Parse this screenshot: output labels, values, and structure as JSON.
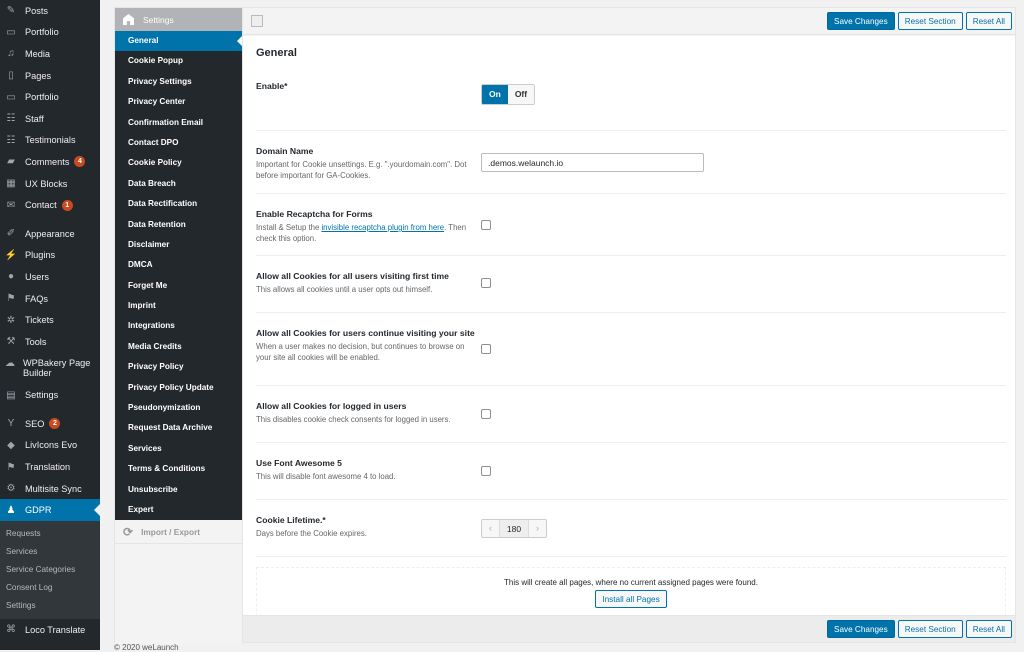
{
  "admin_menu": {
    "items": [
      {
        "label": "Posts",
        "icon": "pin-icon"
      },
      {
        "label": "Portfolio",
        "icon": "folder-icon"
      },
      {
        "label": "Media",
        "icon": "media-icon"
      },
      {
        "label": "Pages",
        "icon": "pages-icon"
      },
      {
        "label": "Portfolio",
        "icon": "folder-icon"
      },
      {
        "label": "Staff",
        "icon": "groups-icon"
      },
      {
        "label": "Testimonials",
        "icon": "groups-icon"
      },
      {
        "label": "Comments",
        "icon": "comment-icon",
        "badge": "4"
      },
      {
        "label": "UX Blocks",
        "icon": "blocks-icon"
      },
      {
        "label": "Contact",
        "icon": "mail-icon",
        "badge": "1"
      },
      {
        "label": "Appearance",
        "icon": "brush-icon"
      },
      {
        "label": "Plugins",
        "icon": "plugin-icon"
      },
      {
        "label": "Users",
        "icon": "user-icon"
      },
      {
        "label": "FAQs",
        "icon": "faq-icon"
      },
      {
        "label": "Tickets",
        "icon": "support-icon"
      },
      {
        "label": "Tools",
        "icon": "wrench-icon"
      },
      {
        "label": "WPBakery Page Builder",
        "icon": "cloud-icon"
      },
      {
        "label": "Settings",
        "icon": "settings-icon"
      },
      {
        "label": "SEO",
        "icon": "yoast-icon",
        "badge": "2"
      },
      {
        "label": "LivIcons Evo",
        "icon": "livicons-icon"
      },
      {
        "label": "Translation",
        "icon": "flag-icon"
      },
      {
        "label": "Multisite Sync",
        "icon": "gear-icon"
      },
      {
        "label": "GDPR",
        "icon": "user-shield-icon"
      },
      {
        "label": "Loco Translate",
        "icon": "translate-icon"
      }
    ],
    "gdpr_submenu": [
      "Requests",
      "Services",
      "Service Categories",
      "Consent Log",
      "Settings"
    ]
  },
  "panel": {
    "section_header": "Settings",
    "tabs": [
      "General",
      "Cookie Popup",
      "Privacy Settings",
      "Privacy Center",
      "Confirmation Email",
      "Contact DPO",
      "Cookie Policy",
      "Data Breach",
      "Data Rectification",
      "Data Retention",
      "Disclaimer",
      "DMCA",
      "Forget Me",
      "Imprint",
      "Integrations",
      "Media Credits",
      "Privacy Policy",
      "Privacy Policy Update",
      "Pseudonymization",
      "Request Data Archive",
      "Services",
      "Terms & Conditions",
      "Unsubscribe",
      "Expert"
    ],
    "import_export": "Import / Export",
    "buttons": {
      "save": "Save Changes",
      "reset_section": "Reset Section",
      "reset_all": "Reset All"
    }
  },
  "content": {
    "title": "General",
    "enable": {
      "label": "Enable*",
      "on": "On",
      "off": "Off",
      "value": "On"
    },
    "domain": {
      "label": "Domain Name",
      "desc": "Important for Cookie unsettings. E.g. \".yourdomain.com\". Dot before important for GA-Cookies.",
      "value": ".demos.welaunch.io"
    },
    "recaptcha": {
      "label": "Enable Recaptcha for Forms",
      "desc_pre": "Install & Setup the ",
      "link": "invisible recaptcha plugin from here",
      "desc_post": ". Then check this option.",
      "checked": false
    },
    "allow_first": {
      "label": "Allow all Cookies for all users visiting first time",
      "desc": "This allows all cookies until a user opts out himself.",
      "checked": false
    },
    "allow_continue": {
      "label": "Allow all Cookies for users continue visiting your site",
      "desc": "When a user makes no decision, but continues to browse on your site all cookies will be enabled.",
      "checked": false
    },
    "allow_logged": {
      "label": "Allow all Cookies for logged in users",
      "desc": "This disables cookie check consents for logged in users.",
      "checked": false
    },
    "font_awesome": {
      "label": "Use Font Awesome 5",
      "desc": "This will disable font awesome 4 to load.",
      "checked": false
    },
    "lifetime": {
      "label": "Cookie Lifetime.*",
      "desc": "Days before the Cookie expires.",
      "value": "180"
    },
    "install": {
      "message": "This will create all pages, where no current assigned pages were found.",
      "button": "Install all Pages"
    }
  },
  "footer": "© 2020 weLaunch"
}
